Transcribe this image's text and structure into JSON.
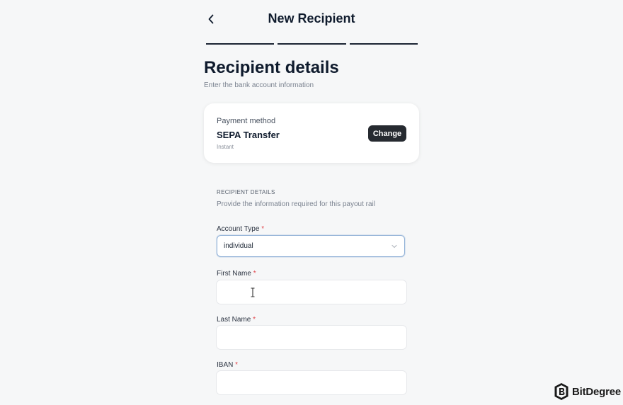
{
  "header": {
    "title": "New Recipient",
    "back_icon": "chevron-left-icon"
  },
  "progress": {
    "steps_total": 3
  },
  "page": {
    "heading": "Recipient details",
    "subheading": "Enter the bank account information"
  },
  "payment_method": {
    "label": "Payment method",
    "name": "SEPA Transfer",
    "speed": "Instant",
    "change_label": "Change"
  },
  "section": {
    "title": "RECIPIENT DETAILS",
    "description": "Provide the information required for this payout rail"
  },
  "fields": {
    "account_type": {
      "label": "Account Type",
      "required_mark": "*",
      "value": "individual",
      "icon": "chevron-down-icon"
    },
    "first_name": {
      "label": "First Name",
      "required_mark": "*",
      "value": ""
    },
    "last_name": {
      "label": "Last Name",
      "required_mark": "*",
      "value": ""
    },
    "iban": {
      "label": "IBAN",
      "required_mark": "*",
      "value": ""
    }
  },
  "watermark": {
    "text": "BitDegree"
  },
  "colors": {
    "accent_button": "#262a30",
    "required": "#e0454b",
    "focus_border": "#8fb0d6",
    "background": "#f6f7f8"
  }
}
